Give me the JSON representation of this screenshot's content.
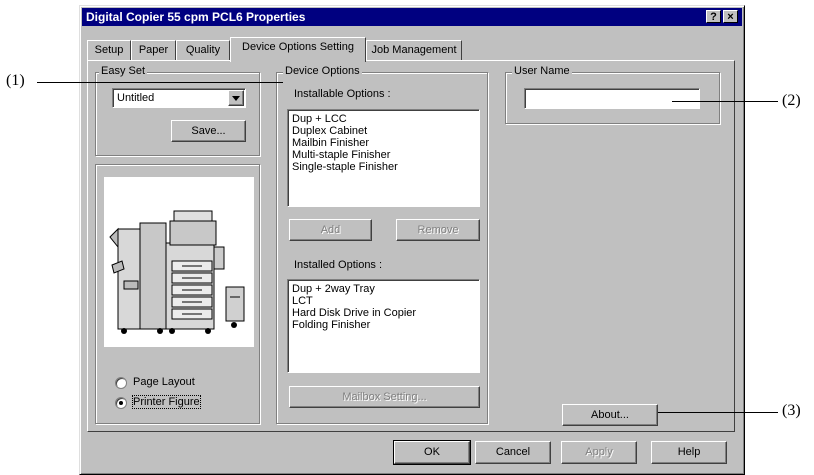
{
  "window": {
    "title": "Digital Copier 55 cpm PCL6 Properties",
    "help_button": "?",
    "close_button": "×"
  },
  "tabs": [
    {
      "label": "Setup"
    },
    {
      "label": "Paper"
    },
    {
      "label": "Quality"
    },
    {
      "label": "Device Options Setting",
      "active": true
    },
    {
      "label": "Job Management"
    }
  ],
  "easy_set": {
    "title": "Easy Set",
    "select_value": "Untitled",
    "save_label": "Save..."
  },
  "device_options": {
    "title": "Device Options",
    "installable_label": "Installable Options :",
    "installable_items": [
      "Dup + LCC",
      "Duplex Cabinet",
      "Mailbin Finisher",
      "Multi-staple Finisher",
      "Single-staple Finisher"
    ],
    "add_label": "Add",
    "remove_label": "Remove",
    "installed_label": "Installed Options :",
    "installed_items": [
      "Dup + 2way Tray",
      "LCT",
      "Hard Disk Drive in Copier",
      "Folding Finisher"
    ],
    "mailbox_label": "Mailbox Setting..."
  },
  "user_name": {
    "title": "User Name",
    "value": ""
  },
  "view_options": {
    "page_layout": "Page Layout",
    "printer_figure": "Printer Figure",
    "selected": "printer_figure"
  },
  "about_label": "About...",
  "footer": {
    "ok": "OK",
    "cancel": "Cancel",
    "apply": "Apply",
    "help": "Help"
  },
  "callouts": {
    "c1": "(1)",
    "c2": "(2)",
    "c3": "(3)"
  },
  "colors": {
    "face": "#c0c0c0",
    "title_bar": "#000080",
    "title_text": "#ffffff"
  }
}
